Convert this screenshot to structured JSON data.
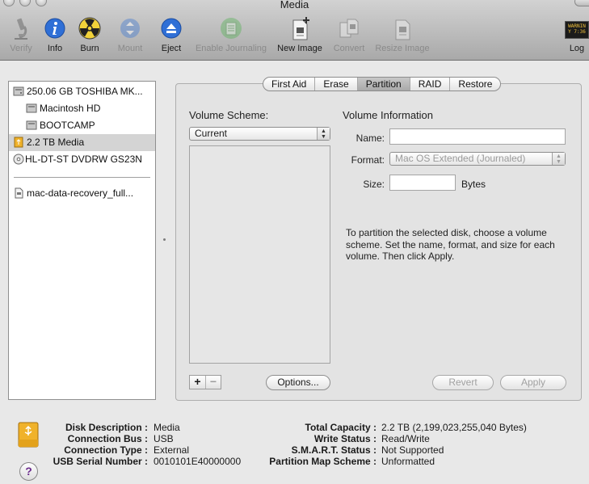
{
  "window": {
    "title": "Media"
  },
  "toolbar": {
    "verify": "Verify",
    "info": "Info",
    "burn": "Burn",
    "mount": "Mount",
    "eject": "Eject",
    "enable_journaling": "Enable Journaling",
    "new_image": "New Image",
    "convert": "Convert",
    "resize_image": "Resize Image",
    "log": "Log",
    "log_badge_line1": "WARNIN",
    "log_badge_line2": "Y 7:36"
  },
  "sidebar": {
    "items": [
      {
        "label": "250.06 GB TOSHIBA MK..."
      },
      {
        "label": "Macintosh HD"
      },
      {
        "label": "BOOTCAMP"
      },
      {
        "label": "2.2 TB Media"
      },
      {
        "label": "HL-DT-ST DVDRW GS23N"
      },
      {
        "label": "mac-data-recovery_full..."
      }
    ]
  },
  "tabs": [
    {
      "label": "First Aid"
    },
    {
      "label": "Erase"
    },
    {
      "label": "Partition"
    },
    {
      "label": "RAID"
    },
    {
      "label": "Restore"
    }
  ],
  "partition": {
    "volume_scheme_label": "Volume Scheme:",
    "volume_scheme_value": "Current",
    "volume_info_label": "Volume Information",
    "name_label": "Name:",
    "format_label": "Format:",
    "format_value": "Mac OS Extended (Journaled)",
    "size_label": "Size:",
    "size_unit": "Bytes",
    "help_text": "To partition the selected disk, choose a volume scheme. Set the name, format, and size for each volume. Then click Apply.",
    "add_label": "+",
    "remove_label": "−",
    "options_label": "Options...",
    "revert_label": "Revert",
    "apply_label": "Apply"
  },
  "details": {
    "left": [
      {
        "label": "Disk Description :",
        "value": "Media"
      },
      {
        "label": "Connection Bus :",
        "value": "USB"
      },
      {
        "label": "Connection Type :",
        "value": "External"
      },
      {
        "label": "USB Serial Number :",
        "value": "0010101E40000000"
      }
    ],
    "right": [
      {
        "label": "Total Capacity :",
        "value": "2.2 TB (2,199,023,255,040 Bytes)"
      },
      {
        "label": "Write Status :",
        "value": "Read/Write"
      },
      {
        "label": "S.M.A.R.T. Status :",
        "value": "Not Supported"
      },
      {
        "label": "Partition Map Scheme :",
        "value": "Unformatted"
      }
    ]
  },
  "help": {
    "label": "?"
  },
  "colors": {
    "selection": "#d4d4d4",
    "info_blue": "#2f6fd6",
    "usb_drive": "#f0b22a"
  }
}
